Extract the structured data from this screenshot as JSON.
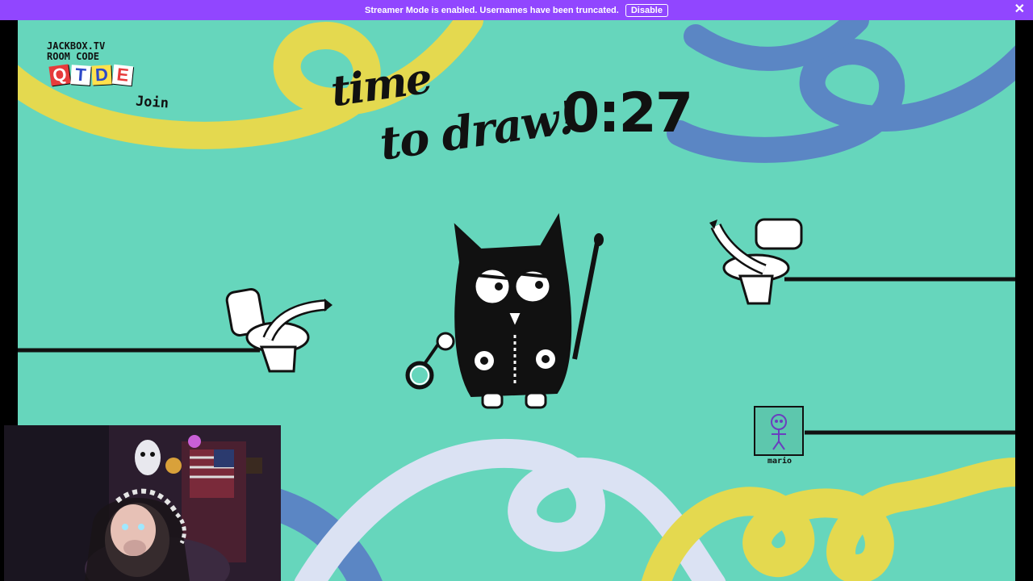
{
  "banner": {
    "message": "Streamer Mode is enabled. Usernames have been truncated.",
    "disable_label": "Disable",
    "close_glyph": "✕",
    "color": "#9146ff"
  },
  "room": {
    "site": "JACKBOX.TV",
    "label": "ROOM CODE",
    "join": "Join",
    "letters": [
      {
        "char": "Q",
        "bg": "#e63b3b",
        "fg": "#ffffff"
      },
      {
        "char": "T",
        "bg": "#ffffff",
        "fg": "#2d48c8"
      },
      {
        "char": "D",
        "bg": "#ffe14d",
        "fg": "#2d48c8"
      },
      {
        "char": "E",
        "bg": "#ffffff",
        "fg": "#e63b3b"
      }
    ]
  },
  "header": {
    "title_line1": "time",
    "title_line2": "to draw!",
    "timer": "0:27"
  },
  "character": {
    "name": "owl-character-icon"
  },
  "players": [
    {
      "name": "mario",
      "avatar": "stick-figure-doodle-icon"
    }
  ],
  "colors": {
    "stage_bg": "#66d6bc",
    "yellow_swirl": "#e4d94f",
    "blue_swirl": "#5b86c4",
    "white_swirl": "#dbe2f3"
  }
}
